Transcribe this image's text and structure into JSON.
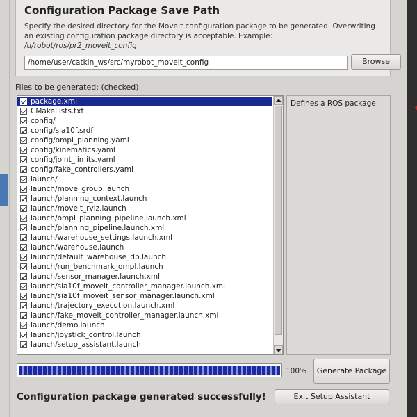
{
  "save_path": {
    "title": "Configuration Package Save Path",
    "description": "Specify the desired directory for the MoveIt configuration package to be generated. Overwriting an existing configuration package directory is acceptable. Example:",
    "example": "/u/robot/ros/pr2_moveit_config",
    "path_value": "/home/user/catkin_ws/src/myrobot_moveit_config",
    "browse_label": "Browse"
  },
  "files": {
    "label": "Files to be generated: (checked)",
    "items": [
      {
        "name": "package.xml",
        "checked": true,
        "selected": true
      },
      {
        "name": "CMakeLists.txt",
        "checked": true
      },
      {
        "name": "config/",
        "checked": true
      },
      {
        "name": "config/sia10f.srdf",
        "checked": true
      },
      {
        "name": "config/ompl_planning.yaml",
        "checked": true
      },
      {
        "name": "config/kinematics.yaml",
        "checked": true
      },
      {
        "name": "config/joint_limits.yaml",
        "checked": true
      },
      {
        "name": "config/fake_controllers.yaml",
        "checked": true
      },
      {
        "name": "launch/",
        "checked": true
      },
      {
        "name": "launch/move_group.launch",
        "checked": true
      },
      {
        "name": "launch/planning_context.launch",
        "checked": true
      },
      {
        "name": "launch/moveit_rviz.launch",
        "checked": true
      },
      {
        "name": "launch/ompl_planning_pipeline.launch.xml",
        "checked": true
      },
      {
        "name": "launch/planning_pipeline.launch.xml",
        "checked": true
      },
      {
        "name": "launch/warehouse_settings.launch.xml",
        "checked": true
      },
      {
        "name": "launch/warehouse.launch",
        "checked": true
      },
      {
        "name": "launch/default_warehouse_db.launch",
        "checked": true
      },
      {
        "name": "launch/run_benchmark_ompl.launch",
        "checked": true
      },
      {
        "name": "launch/sensor_manager.launch.xml",
        "checked": true
      },
      {
        "name": "launch/sia10f_moveit_controller_manager.launch.xml",
        "checked": true
      },
      {
        "name": "launch/sia10f_moveit_sensor_manager.launch.xml",
        "checked": true
      },
      {
        "name": "launch/trajectory_execution.launch.xml",
        "checked": true
      },
      {
        "name": "launch/fake_moveit_controller_manager.launch.xml",
        "checked": true
      },
      {
        "name": "launch/demo.launch",
        "checked": true
      },
      {
        "name": "launch/joystick_control.launch",
        "checked": true
      },
      {
        "name": "launch/setup_assistant.launch",
        "checked": true
      }
    ]
  },
  "description_panel": {
    "text": "Defines a ROS package"
  },
  "progress": {
    "percent": 100,
    "label": "100%"
  },
  "actions": {
    "generate_label": "Generate Package",
    "exit_label": "Exit Setup Assistant"
  },
  "status": {
    "message": "Configuration package generated successfully!"
  },
  "colors": {
    "selection": "#1b2a8f",
    "progress": "#1c2aa3",
    "window_bg": "#d6d4d1"
  }
}
